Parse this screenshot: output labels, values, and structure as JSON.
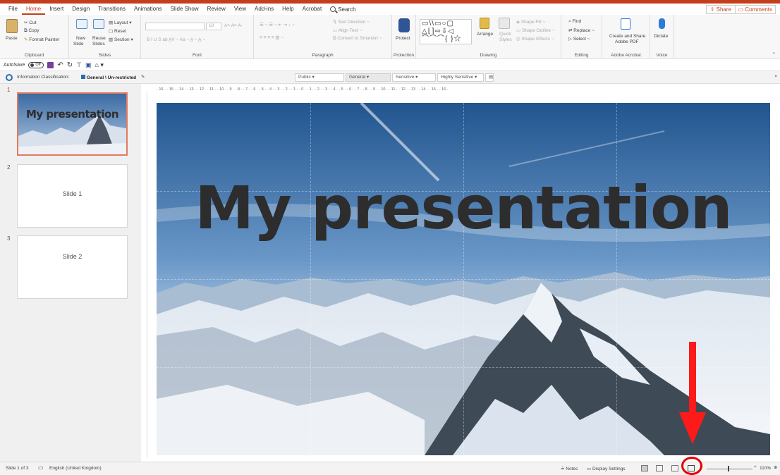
{
  "menu": {
    "tabs": [
      "File",
      "Home",
      "Insert",
      "Design",
      "Transitions",
      "Animations",
      "Slide Show",
      "Review",
      "View",
      "Add-ins",
      "Help",
      "Acrobat"
    ],
    "search_label": "Search",
    "share_label": "Share",
    "comments_label": "Comments"
  },
  "ribbon": {
    "clipboard": {
      "paste": "Paste",
      "cut": "Cut",
      "copy": "Copy",
      "format_painter": "Format Painter",
      "label": "Clipboard"
    },
    "slides": {
      "new_slide": "New",
      "new_slide_2": "Slide",
      "reuse": "Reuse",
      "reuse_2": "Slides",
      "layout": "Layout",
      "reset": "Reset",
      "section": "Section",
      "label": "Slides"
    },
    "font": {
      "size": "18",
      "label": "Font"
    },
    "paragraph": {
      "text_direction": "Text Direction",
      "align_text": "Align Text",
      "convert": "Convert to SmartArt",
      "label": "Paragraph"
    },
    "protection": {
      "protect": "Protect",
      "label": "Protection"
    },
    "drawing": {
      "arrange": "Arrange",
      "quick_styles": "Quick",
      "quick_styles_2": "Styles",
      "shape_fill": "Shape Fill",
      "shape_outline": "Shape Outline",
      "shape_effects": "Shape Effects",
      "label": "Drawing"
    },
    "editing": {
      "find": "Find",
      "replace": "Replace",
      "select": "Select",
      "label": "Editing"
    },
    "acrobat": {
      "create_share": "Create and Share",
      "adobe_pdf": "Adobe PDF",
      "label": "Adobe Acrobat"
    },
    "voice": {
      "dictate": "Dictate",
      "label": "Voice"
    }
  },
  "qat": {
    "autosave": "AutoSave",
    "toggle": "Off"
  },
  "classification": {
    "label": "Information Classification:",
    "value": "General \\ Un-restricted",
    "levels": [
      "Public",
      "General",
      "Sensitive",
      "Highly Sensitive"
    ]
  },
  "ruler": {
    "ticks": "· 16 · · 15 · · 14 · · 13 · · 12 · · 11 · · 10 · · 9 · · 8 · · 7 · · 6 · · 5 · · 4 · · 3 · · 2 · · 1 · · 0 · · 1 · · 2 · · 3 · · 4 · · 5 · · 6 · · 7 · · 8 · · 9 · · 10 · · 11 · · 12 · · 13 · · 14 · · 15 · · 16 ·"
  },
  "thumbnails": [
    {
      "number": "1",
      "title": "My presentation",
      "selected": true
    },
    {
      "number": "2",
      "title": "Slide 1",
      "selected": false
    },
    {
      "number": "3",
      "title": "Slide 2",
      "selected": false
    }
  ],
  "slide": {
    "title": "My presentation"
  },
  "status": {
    "slide_count": "Slide 1 of 3",
    "language": "English (United Kingdom)",
    "notes": "Notes",
    "display_settings": "Display Settings",
    "zoom": "110%"
  },
  "colors": {
    "accent": "#c43e1c",
    "annotation": "#ff1a1a"
  }
}
